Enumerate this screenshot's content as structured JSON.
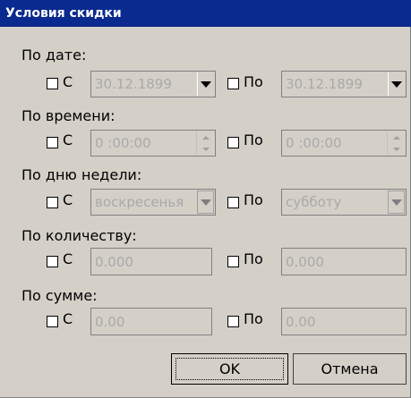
{
  "window": {
    "title": "Условия скидки"
  },
  "sections": {
    "date": {
      "label": "По дате:",
      "from_label": "С",
      "to_label": "По",
      "from_value": "30.12.1899",
      "to_value": "30.12.1899"
    },
    "time": {
      "label": "По времени:",
      "from_label": "С",
      "to_label": "По",
      "from_value": "0 :00:00",
      "to_value": "0 :00:00"
    },
    "weekday": {
      "label": "По дню недели:",
      "from_label": "С",
      "to_label": "По",
      "from_value": "воскресенья",
      "to_value": "субботу"
    },
    "quantity": {
      "label": "По количеству:",
      "from_label": "С",
      "to_label": "По",
      "from_value": "0.000",
      "to_value": "0.000"
    },
    "sum": {
      "label": "По сумме:",
      "from_label": "С",
      "to_label": "По",
      "from_value": "0.00",
      "to_value": "0.00"
    }
  },
  "buttons": {
    "ok": "OK",
    "cancel": "Отмена"
  },
  "icons": {
    "dropdown": "chevron-down-icon",
    "spin_up": "spin-up-icon",
    "spin_down": "spin-down-icon"
  },
  "colors": {
    "titlebar": "#0b2a8f",
    "face": "#d4d0c8",
    "disabled_text": "#a9a9a9"
  }
}
